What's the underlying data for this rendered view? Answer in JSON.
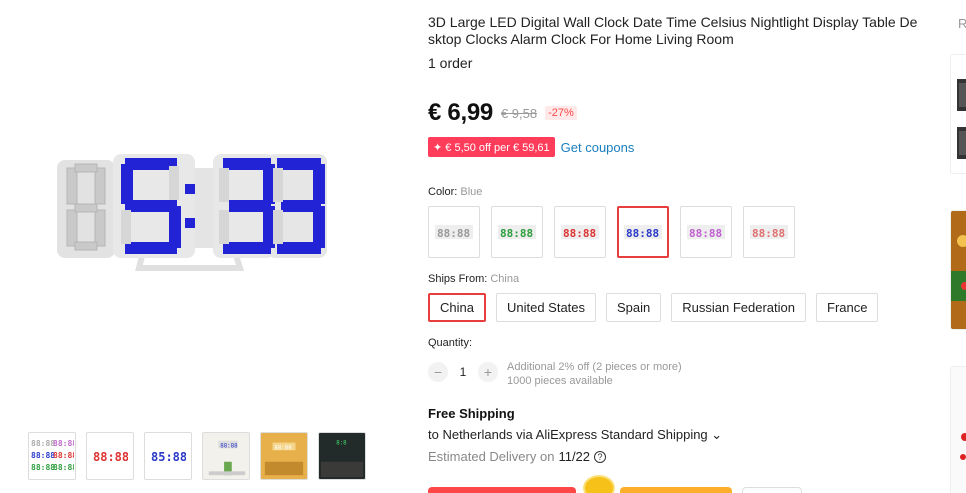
{
  "product": {
    "title": "3D Large LED Digital Wall Clock Date Time Celsius Nightlight Display Table Desktop Clocks Alarm Clock For Home Living Room",
    "orders": "1 order",
    "price": "€ 6,99",
    "old_price": "€ 9,58",
    "discount": "-27%",
    "coupon": "✦ € 5,50 off per € 59,61",
    "get_coupons": "Get coupons"
  },
  "color": {
    "label": "Color:",
    "selected": "Blue",
    "options": [
      {
        "name": "gray",
        "digit_color": "#9a9a9a"
      },
      {
        "name": "green",
        "digit_color": "#2e9e3e"
      },
      {
        "name": "red",
        "digit_color": "#d33"
      },
      {
        "name": "blue",
        "digit_color": "#2a39c8",
        "selected": true
      },
      {
        "name": "purple",
        "digit_color": "#c060d0"
      },
      {
        "name": "rose",
        "digit_color": "#e07070"
      }
    ]
  },
  "ships_from": {
    "label": "Ships From:",
    "selected": "China",
    "options": [
      "China",
      "United States",
      "Spain",
      "Russian Federation",
      "France"
    ]
  },
  "quantity": {
    "label": "Quantity:",
    "minus": "−",
    "value": "1",
    "plus": "+",
    "note1": "Additional 2% off (2 pieces or more)",
    "note2": "1000 pieces available"
  },
  "shipping": {
    "title": "Free Shipping",
    "to": "to Netherlands via AliExpress Standard Shipping ⌄",
    "delivery_prefix": "Estimated Delivery on",
    "delivery_date": "11/22",
    "help_icon": "?"
  },
  "rail": {
    "label": "R"
  },
  "colors": {
    "accent": "#e63d3d",
    "coupon_bg": "#ff3c5a",
    "link": "#1a7fbf",
    "led_blue": "#2020d8"
  }
}
